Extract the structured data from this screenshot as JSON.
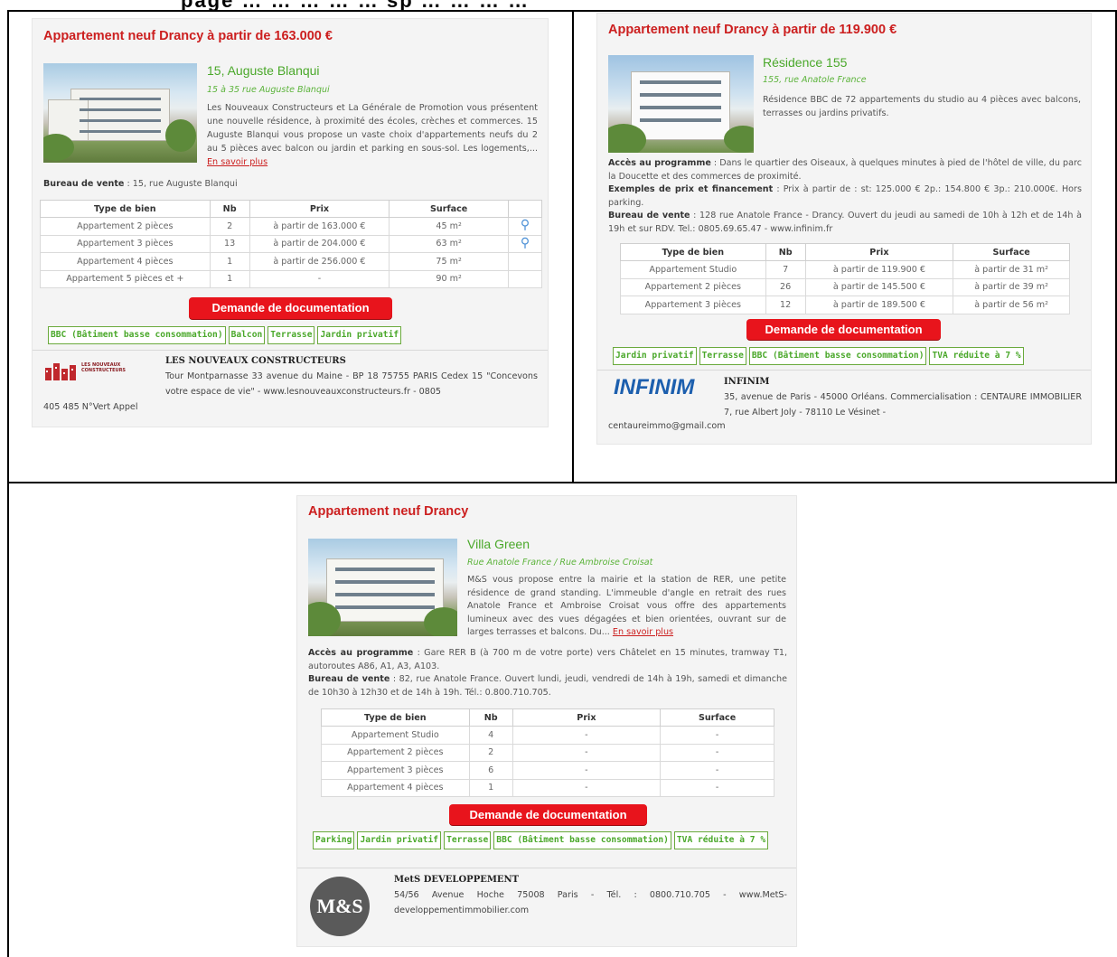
{
  "header": {
    "text": "page … … … … … sp … … … …"
  },
  "listings": [
    {
      "title": "Appartement neuf Drancy à partir de 163.000 €",
      "program_name": "15, Auguste Blanqui",
      "program_address": "15 à 35 rue Auguste Blanqui",
      "description": "Les Nouveaux Constructeurs et La Générale de Promotion vous présentent une nouvelle résidence, à proximité des écoles, crèches et commerces. 15 Auguste Blanqui vous propose un vaste choix d'appartements neufs du 2 au 5 pièces avec balcon ou jardin et parking en sous-sol. Les logements,...",
      "more_link": "En savoir plus",
      "sales_office_label": "Bureau de vente",
      "sales_office_value": " : 15, rue Auguste Blanqui",
      "table_headers": [
        "Type de bien",
        "Nb",
        "Prix",
        "Surface",
        ""
      ],
      "rows": [
        [
          "Appartement 2 pièces",
          "2",
          "à partir de 163.000 €",
          "45 m²"
        ],
        [
          "Appartement 3 pièces",
          "13",
          "à partir de 204.000 €",
          "63 m²"
        ],
        [
          "Appartement 4 pièces",
          "1",
          "à partir de 256.000 €",
          "75 m²"
        ],
        [
          "Appartement 5 pièces et +",
          "1",
          "-",
          "90 m²"
        ]
      ],
      "doc_button": "Demande de documentation",
      "tags": [
        "BBC (Bâtiment basse consommation)",
        "Balcon",
        "Terrasse",
        "Jardin privatif"
      ],
      "agency_name": "LES NOUVEAUX CONSTRUCTEURS",
      "agency_text": "Tour Montparnasse 33 avenue du Maine - BP 18 75755 PARIS Cedex 15 \"Concevons votre espace de vie\" - www.lesnouveauxconstructeurs.fr - 0805",
      "agency_text_2": "405 485 N°Vert Appel",
      "logo_text": "LES NOUVEAUX CONSTRUCTEURS"
    },
    {
      "title": "Appartement neuf Drancy à partir de 119.900 €",
      "program_name": "Résidence 155",
      "program_address": "155, rue Anatole France",
      "description": "Résidence BBC de 72 appartements du studio au 4 pièces avec balcons, terrasses ou jardins privatifs.",
      "access_label": "Accès au programme",
      "access_value": " : Dans le quartier des Oiseaux, à quelques minutes à pied de l'hôtel de ville, du parc la Doucette et des commerces de proximité.",
      "examples_label": "Exemples de prix et financement",
      "examples_value": " : Prix à partir de : st: 125.000 € 2p.: 154.800 € 3p.: 210.000€. Hors parking.",
      "sales_office_label": "Bureau de vente",
      "sales_office_value": " : 128 rue Anatole France - Drancy. Ouvert du jeudi au samedi de 10h à 12h et de 14h à 19h et sur RDV. Tel.: 0805.69.65.47 - www.infinim.fr",
      "table_headers": [
        "Type de bien",
        "Nb",
        "Prix",
        "Surface"
      ],
      "rows": [
        [
          "Appartement Studio",
          "7",
          "à partir de 119.900 €",
          "à partir de 31 m²"
        ],
        [
          "Appartement 2 pièces",
          "26",
          "à partir de 145.500 €",
          "à partir de 39 m²"
        ],
        [
          "Appartement 3 pièces",
          "12",
          "à partir de 189.500 €",
          "à partir de 56 m²"
        ]
      ],
      "doc_button": "Demande de documentation",
      "tags": [
        "Jardin privatif",
        "Terrasse",
        "BBC (Bâtiment basse consommation)",
        "TVA réduite à 7 %"
      ],
      "agency_name": "INFINIM",
      "agency_text": "35, avenue de Paris - 45000 Orléans. Commercialisation : CENTAURE IMMOBILIER 7, rue Albert Joly - 78110 Le Vésinet -",
      "agency_text_2": "centaureimmo@gmail.com",
      "logo_text": "INFINIM"
    },
    {
      "title": "Appartement neuf Drancy",
      "program_name": "Villa Green",
      "program_address": "Rue Anatole France / Rue Ambroise Croisat",
      "description": "M&S vous propose entre la mairie et la station de RER, une petite résidence de grand standing. L'immeuble d'angle en retrait des rues Anatole France et Ambroise Croisat vous offre des appartements lumineux avec des vues dégagées et bien orientées, ouvrant sur de larges terrasses et balcons. Du...",
      "more_link": "En savoir plus",
      "access_label": "Accès au programme",
      "access_value": " : Gare RER B (à 700 m de votre porte) vers Châtelet en 15 minutes, tramway T1, autoroutes A86, A1, A3, A103.",
      "sales_office_label": "Bureau de vente",
      "sales_office_value": " : 82, rue Anatole France. Ouvert lundi, jeudi, vendredi de 14h à 19h, samedi et dimanche de 10h30 à 12h30 et de 14h à 19h. Tél.: 0.800.710.705.",
      "table_headers": [
        "Type de bien",
        "Nb",
        "Prix",
        "Surface"
      ],
      "rows": [
        [
          "Appartement Studio",
          "4",
          "-",
          "-"
        ],
        [
          "Appartement 2 pièces",
          "2",
          "-",
          "-"
        ],
        [
          "Appartement 3 pièces",
          "6",
          "-",
          "-"
        ],
        [
          "Appartement 4 pièces",
          "1",
          "-",
          "-"
        ]
      ],
      "doc_button": "Demande de documentation",
      "tags": [
        "Parking",
        "Jardin privatif",
        "Terrasse",
        "BBC (Bâtiment basse consommation)",
        "TVA réduite à 7 %"
      ],
      "agency_name": "MetS DEVELOPPEMENT",
      "agency_text": "54/56 Avenue Hoche 75008 Paris - Tél. : 0800.710.705 - www.MetS-developpementimmobilier.com",
      "logo_text": "M&S"
    }
  ]
}
